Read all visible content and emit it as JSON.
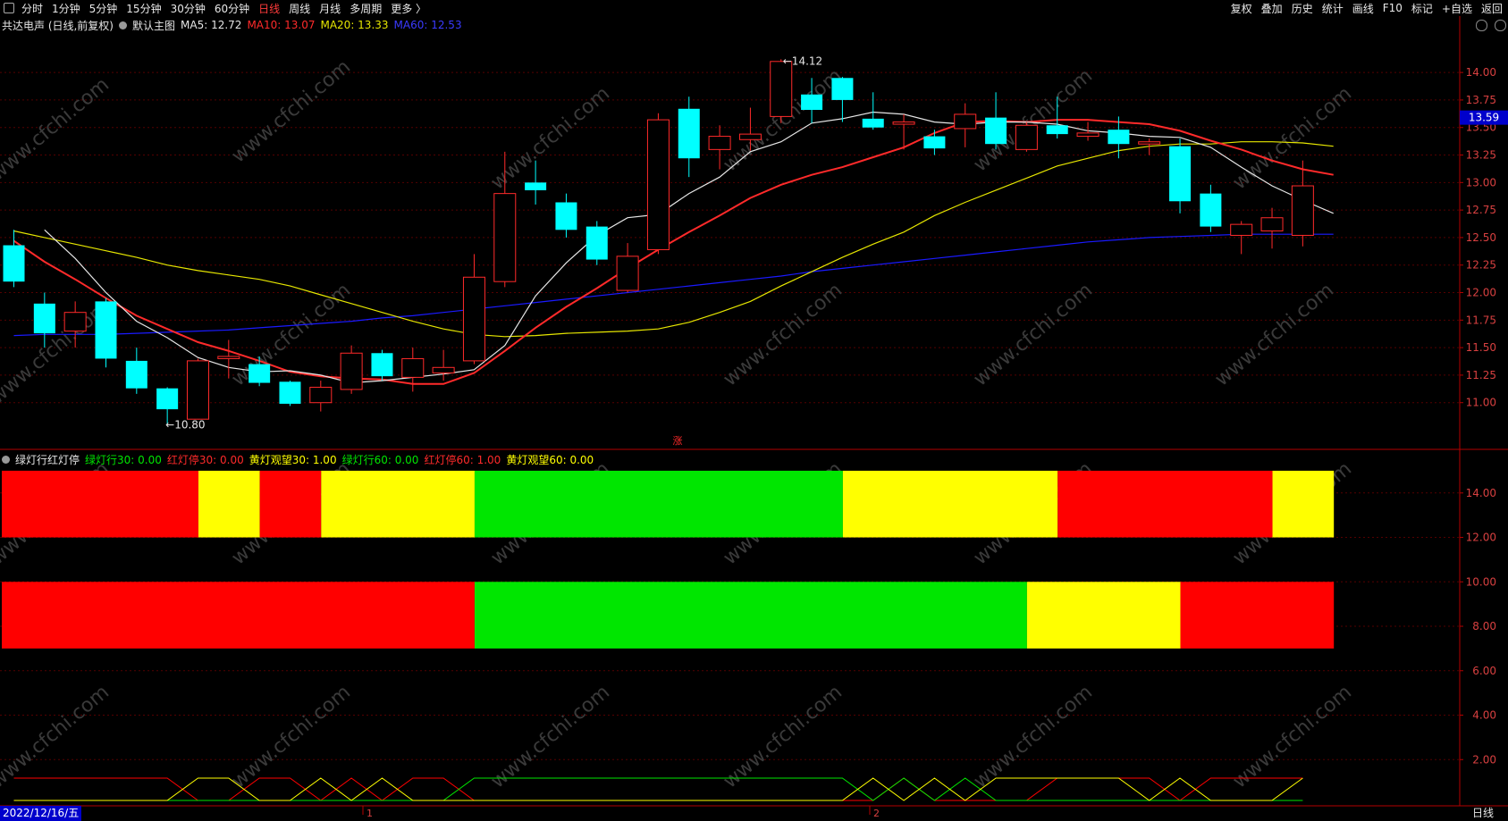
{
  "toolbar": {
    "left": [
      "分时",
      "1分钟",
      "5分钟",
      "15分钟",
      "30分钟",
      "60分钟",
      "日线",
      "周线",
      "月线",
      "多周期",
      "更多 〉"
    ],
    "active": "日线",
    "right": [
      "复权",
      "叠加",
      "历史",
      "统计",
      "画线",
      "F10",
      "标记",
      "+自选",
      "返回"
    ]
  },
  "main_title": {
    "stock": "共达电声 (日线,前复权)",
    "template": "默认主图",
    "ma5": "MA5: 12.72",
    "ma10": "MA10: 13.07",
    "ma20": "MA20: 13.33",
    "ma60": "MA60: 12.53"
  },
  "sub_title": {
    "name": "绿灯行红灯停",
    "g30": "绿灯行30: 0.00",
    "r30": "红灯停30: 0.00",
    "y30": "黄灯观望30: 1.00",
    "g60": "绿灯行60: 0.00",
    "r60": "红灯停60: 1.00",
    "y60": "黄灯观望60: 0.00"
  },
  "annotations": {
    "high": "14.12",
    "low": "10.80",
    "mark": "涨"
  },
  "current_price": "13.59",
  "bottom": {
    "date": "2022/12/16/五",
    "period": "日线",
    "month_marks": [
      "1",
      "2"
    ]
  },
  "watermark": "www.cfchi.com",
  "colors": {
    "up": "#ff2a2a",
    "down": "#00ffff",
    "ma5": "#e6e6e6",
    "ma10": "#ff2a2a",
    "ma20": "#e6e600",
    "ma60": "#1a1aff",
    "green": "#00e600",
    "yellow": "#ffff00",
    "red": "#ff0000",
    "axis": "#b30000"
  },
  "chart_data": [
    {
      "type": "candlestick",
      "ylim": [
        10.6,
        14.35
      ],
      "yticks": [
        11.0,
        11.25,
        11.5,
        11.75,
        12.0,
        12.25,
        12.5,
        12.75,
        13.0,
        13.25,
        13.5,
        13.75,
        14.0
      ],
      "candles": [
        {
          "o": 12.43,
          "c": 12.1,
          "h": 12.57,
          "l": 12.05
        },
        {
          "o": 11.9,
          "c": 11.63,
          "h": 12.0,
          "l": 11.5
        },
        {
          "o": 11.65,
          "c": 11.82,
          "h": 11.92,
          "l": 11.5
        },
        {
          "o": 11.92,
          "c": 11.4,
          "h": 11.95,
          "l": 11.32
        },
        {
          "o": 11.38,
          "c": 11.13,
          "h": 11.5,
          "l": 11.08
        },
        {
          "o": 11.13,
          "c": 10.94,
          "h": 11.14,
          "l": 10.8
        },
        {
          "o": 10.85,
          "c": 11.38,
          "h": 11.4,
          "l": 10.85
        },
        {
          "o": 11.4,
          "c": 11.42,
          "h": 11.57,
          "l": 11.22
        },
        {
          "o": 11.35,
          "c": 11.18,
          "h": 11.42,
          "l": 11.15
        },
        {
          "o": 11.19,
          "c": 10.99,
          "h": 11.2,
          "l": 10.97
        },
        {
          "o": 11.0,
          "c": 11.14,
          "h": 11.2,
          "l": 10.92
        },
        {
          "o": 11.12,
          "c": 11.45,
          "h": 11.52,
          "l": 11.08
        },
        {
          "o": 11.45,
          "c": 11.24,
          "h": 11.48,
          "l": 11.2
        },
        {
          "o": 11.23,
          "c": 11.4,
          "h": 11.5,
          "l": 11.1
        },
        {
          "o": 11.27,
          "c": 11.32,
          "h": 11.48,
          "l": 11.2
        },
        {
          "o": 11.38,
          "c": 12.14,
          "h": 12.35,
          "l": 11.35
        },
        {
          "o": 12.1,
          "c": 12.9,
          "h": 13.28,
          "l": 12.05
        },
        {
          "o": 13.0,
          "c": 12.93,
          "h": 13.2,
          "l": 12.8
        },
        {
          "o": 12.82,
          "c": 12.57,
          "h": 12.9,
          "l": 12.5
        },
        {
          "o": 12.6,
          "c": 12.3,
          "h": 12.65,
          "l": 12.25
        },
        {
          "o": 12.02,
          "c": 12.33,
          "h": 12.45,
          "l": 12.0
        },
        {
          "o": 12.39,
          "c": 13.57,
          "h": 13.63,
          "l": 12.35
        },
        {
          "o": 13.67,
          "c": 13.22,
          "h": 13.78,
          "l": 13.05
        },
        {
          "o": 13.3,
          "c": 13.42,
          "h": 13.52,
          "l": 13.12
        },
        {
          "o": 13.39,
          "c": 13.44,
          "h": 13.68,
          "l": 13.29
        },
        {
          "o": 13.6,
          "c": 14.1,
          "h": 14.12,
          "l": 13.54
        },
        {
          "o": 13.8,
          "c": 13.66,
          "h": 13.95,
          "l": 13.54
        },
        {
          "o": 13.95,
          "c": 13.75,
          "h": 13.96,
          "l": 13.55
        },
        {
          "o": 13.58,
          "c": 13.5,
          "h": 13.82,
          "l": 13.48
        },
        {
          "o": 13.53,
          "c": 13.55,
          "h": 13.62,
          "l": 13.3
        },
        {
          "o": 13.42,
          "c": 13.31,
          "h": 13.48,
          "l": 13.25
        },
        {
          "o": 13.49,
          "c": 13.62,
          "h": 13.72,
          "l": 13.32
        },
        {
          "o": 13.59,
          "c": 13.35,
          "h": 13.82,
          "l": 13.3
        },
        {
          "o": 13.3,
          "c": 13.52,
          "h": 13.55,
          "l": 13.28
        },
        {
          "o": 13.52,
          "c": 13.44,
          "h": 13.78,
          "l": 13.4
        },
        {
          "o": 13.42,
          "c": 13.45,
          "h": 13.55,
          "l": 13.38
        },
        {
          "o": 13.48,
          "c": 13.35,
          "h": 13.6,
          "l": 13.22
        },
        {
          "o": 13.35,
          "c": 13.37,
          "h": 13.4,
          "l": 13.25
        },
        {
          "o": 13.33,
          "c": 12.83,
          "h": 13.4,
          "l": 12.72
        },
        {
          "o": 12.9,
          "c": 12.6,
          "h": 12.98,
          "l": 12.55
        },
        {
          "o": 12.52,
          "c": 12.62,
          "h": 12.65,
          "l": 12.35
        },
        {
          "o": 12.56,
          "c": 12.68,
          "h": 12.77,
          "l": 12.4
        },
        {
          "o": 12.52,
          "c": 12.97,
          "h": 13.2,
          "l": 12.42
        }
      ],
      "ma5": [
        12.57,
        12.31,
        12.0,
        11.74,
        11.59,
        11.41,
        11.32,
        11.28,
        11.29,
        11.25,
        11.18,
        11.2,
        11.23,
        11.26,
        11.3,
        11.52,
        11.97,
        12.27,
        12.52,
        12.68,
        12.71,
        12.9,
        13.05,
        13.28,
        13.37,
        13.54,
        13.58,
        13.64,
        13.62,
        13.55,
        13.53,
        13.55,
        13.55,
        13.53,
        13.47,
        13.45,
        13.42,
        13.41,
        13.32,
        13.14,
        12.97,
        12.84,
        12.72
      ],
      "ma10": [
        12.47,
        12.28,
        12.12,
        11.95,
        11.79,
        11.67,
        11.55,
        11.47,
        11.38,
        11.28,
        11.24,
        11.22,
        11.21,
        11.17,
        11.17,
        11.27,
        11.47,
        11.68,
        11.87,
        12.04,
        12.22,
        12.39,
        12.55,
        12.7,
        12.86,
        12.98,
        13.07,
        13.14,
        13.23,
        13.32,
        13.45,
        13.55,
        13.56,
        13.55,
        13.57,
        13.57,
        13.55,
        13.53,
        13.47,
        13.38,
        13.3,
        13.2,
        13.12,
        13.07
      ],
      "ma20": [
        12.56,
        12.5,
        12.44,
        12.38,
        12.32,
        12.25,
        12.2,
        12.16,
        12.12,
        12.06,
        11.98,
        11.9,
        11.82,
        11.74,
        11.67,
        11.62,
        11.6,
        11.61,
        11.63,
        11.64,
        11.65,
        11.67,
        11.73,
        11.82,
        11.92,
        12.06,
        12.19,
        12.32,
        12.44,
        12.55,
        12.7,
        12.82,
        12.93,
        13.04,
        13.15,
        13.22,
        13.29,
        13.33,
        13.35,
        13.35,
        13.37,
        13.37,
        13.36,
        13.33
      ],
      "ma60": [
        11.61,
        11.62,
        11.62,
        11.62,
        11.63,
        11.64,
        11.65,
        11.66,
        11.68,
        11.7,
        11.72,
        11.74,
        11.77,
        11.79,
        11.82,
        11.85,
        11.88,
        11.91,
        11.94,
        11.97,
        12.0,
        12.03,
        12.06,
        12.09,
        12.12,
        12.15,
        12.19,
        12.22,
        12.25,
        12.28,
        12.31,
        12.34,
        12.37,
        12.4,
        12.43,
        12.46,
        12.48,
        12.5,
        12.51,
        12.52,
        12.53,
        12.53,
        12.53,
        12.53
      ]
    },
    {
      "type": "indicator",
      "ylim": [
        0,
        15.6
      ],
      "yticks": [
        2,
        4,
        6,
        8,
        10,
        12,
        14
      ],
      "bars": [
        {
          "y0": 12,
          "y1": 15,
          "segments": [
            {
              "from": 0,
              "to": 6.5,
              "state": "red"
            },
            {
              "from": 6.5,
              "to": 8.5,
              "state": "yellow"
            },
            {
              "from": 8.5,
              "to": 10.5,
              "state": "red"
            },
            {
              "from": 10.5,
              "to": 15.5,
              "state": "yellow"
            },
            {
              "from": 15.5,
              "to": 27.5,
              "state": "green"
            },
            {
              "from": 27.5,
              "to": 34.5,
              "state": "yellow"
            },
            {
              "from": 34.5,
              "to": 41.5,
              "state": "red"
            },
            {
              "from": 41.5,
              "to": 43.5,
              "state": "yellow"
            }
          ]
        },
        {
          "y0": 7,
          "y1": 10,
          "segments": [
            {
              "from": 0,
              "to": 15.5,
              "state": "red"
            },
            {
              "from": 15.5,
              "to": 33.5,
              "state": "green"
            },
            {
              "from": 33.5,
              "to": 38.5,
              "state": "yellow"
            },
            {
              "from": 38.5,
              "to": 43.5,
              "state": "red"
            }
          ]
        }
      ],
      "signal_lines": [
        {
          "name": "red",
          "values": [
            1,
            1,
            1,
            1,
            1,
            1,
            0,
            0,
            1,
            1,
            0,
            1,
            0,
            1,
            1,
            0,
            0,
            0,
            0,
            0,
            0,
            0,
            0,
            0,
            0,
            0,
            0,
            0,
            0,
            1,
            0,
            0,
            0,
            0,
            1,
            1,
            1,
            1,
            0,
            1,
            1,
            1,
            1
          ]
        },
        {
          "name": "green",
          "values": [
            0,
            0,
            0,
            0,
            0,
            0,
            0,
            0,
            0,
            0,
            0,
            0,
            0,
            0,
            0,
            1,
            1,
            1,
            1,
            1,
            1,
            1,
            1,
            1,
            1,
            1,
            1,
            1,
            0,
            1,
            0,
            1,
            0,
            0,
            0,
            0,
            0,
            0,
            0,
            0,
            0,
            0,
            0
          ]
        },
        {
          "name": "yellow",
          "values": [
            0,
            0,
            0,
            0,
            0,
            0,
            1,
            1,
            0,
            0,
            1,
            0,
            1,
            0,
            0,
            0,
            0,
            0,
            0,
            0,
            0,
            0,
            0,
            0,
            0,
            0,
            0,
            0,
            1,
            0,
            1,
            0,
            1,
            1,
            1,
            1,
            1,
            0,
            1,
            0,
            0,
            0,
            1
          ]
        }
      ]
    }
  ]
}
